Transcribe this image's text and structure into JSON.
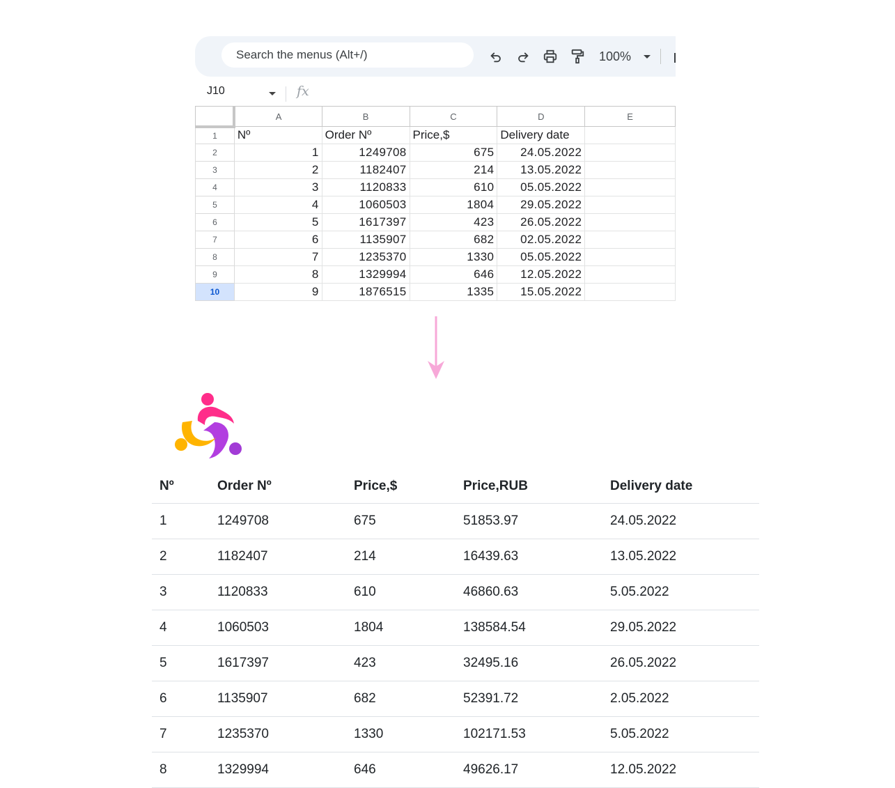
{
  "toolbar": {
    "search_placeholder": "Search the menus (Alt+/)",
    "zoom": "100%",
    "buttons": [
      "undo-icon",
      "redo-icon",
      "print-icon",
      "paint-format-icon"
    ]
  },
  "formula_bar": {
    "cell_ref": "J10",
    "fx_label": "fx"
  },
  "spreadsheet": {
    "columns": [
      "A",
      "B",
      "C",
      "D",
      "E"
    ],
    "selected_row": "10",
    "rows": [
      {
        "row": "1",
        "a": "Nº",
        "b": "Order Nº",
        "c": "Price,$",
        "d": "Delivery date",
        "e": ""
      },
      {
        "row": "2",
        "a": "1",
        "b": "1249708",
        "c": "675",
        "d": "24.05.2022",
        "e": ""
      },
      {
        "row": "3",
        "a": "2",
        "b": "1182407",
        "c": "214",
        "d": "13.05.2022",
        "e": ""
      },
      {
        "row": "4",
        "a": "3",
        "b": "1120833",
        "c": "610",
        "d": "05.05.2022",
        "e": ""
      },
      {
        "row": "5",
        "a": "4",
        "b": "1060503",
        "c": "1804",
        "d": "29.05.2022",
        "e": ""
      },
      {
        "row": "6",
        "a": "5",
        "b": "1617397",
        "c": "423",
        "d": "26.05.2022",
        "e": ""
      },
      {
        "row": "7",
        "a": "6",
        "b": "1135907",
        "c": "682",
        "d": "02.05.2022",
        "e": ""
      },
      {
        "row": "8",
        "a": "7",
        "b": "1235370",
        "c": "1330",
        "d": "05.05.2022",
        "e": ""
      },
      {
        "row": "9",
        "a": "8",
        "b": "1329994",
        "c": "646",
        "d": "12.05.2022",
        "e": ""
      },
      {
        "row": "10",
        "a": "9",
        "b": "1876515",
        "c": "1335",
        "d": "15.05.2022",
        "e": ""
      }
    ]
  },
  "arrow": {
    "color": "#f7a8d8"
  },
  "logo": {
    "icon": "people-swirl-logo",
    "colors": [
      "#ff2d8a",
      "#a23bd6",
      "#ffb400"
    ]
  },
  "result_table": {
    "headers": [
      "Nº",
      "Order Nº",
      "Price,$",
      "Price,RUB",
      "Delivery date"
    ],
    "rows": [
      [
        "1",
        "1249708",
        "675",
        "51853.97",
        "24.05.2022"
      ],
      [
        "2",
        "1182407",
        "214",
        "16439.63",
        "13.05.2022"
      ],
      [
        "3",
        "1120833",
        "610",
        "46860.63",
        "5.05.2022"
      ],
      [
        "4",
        "1060503",
        "1804",
        "138584.54",
        "29.05.2022"
      ],
      [
        "5",
        "1617397",
        "423",
        "32495.16",
        "26.05.2022"
      ],
      [
        "6",
        "1135907",
        "682",
        "52391.72",
        "2.05.2022"
      ],
      [
        "7",
        "1235370",
        "1330",
        "102171.53",
        "5.05.2022"
      ],
      [
        "8",
        "1329994",
        "646",
        "49626.17",
        "12.05.2022"
      ]
    ]
  }
}
